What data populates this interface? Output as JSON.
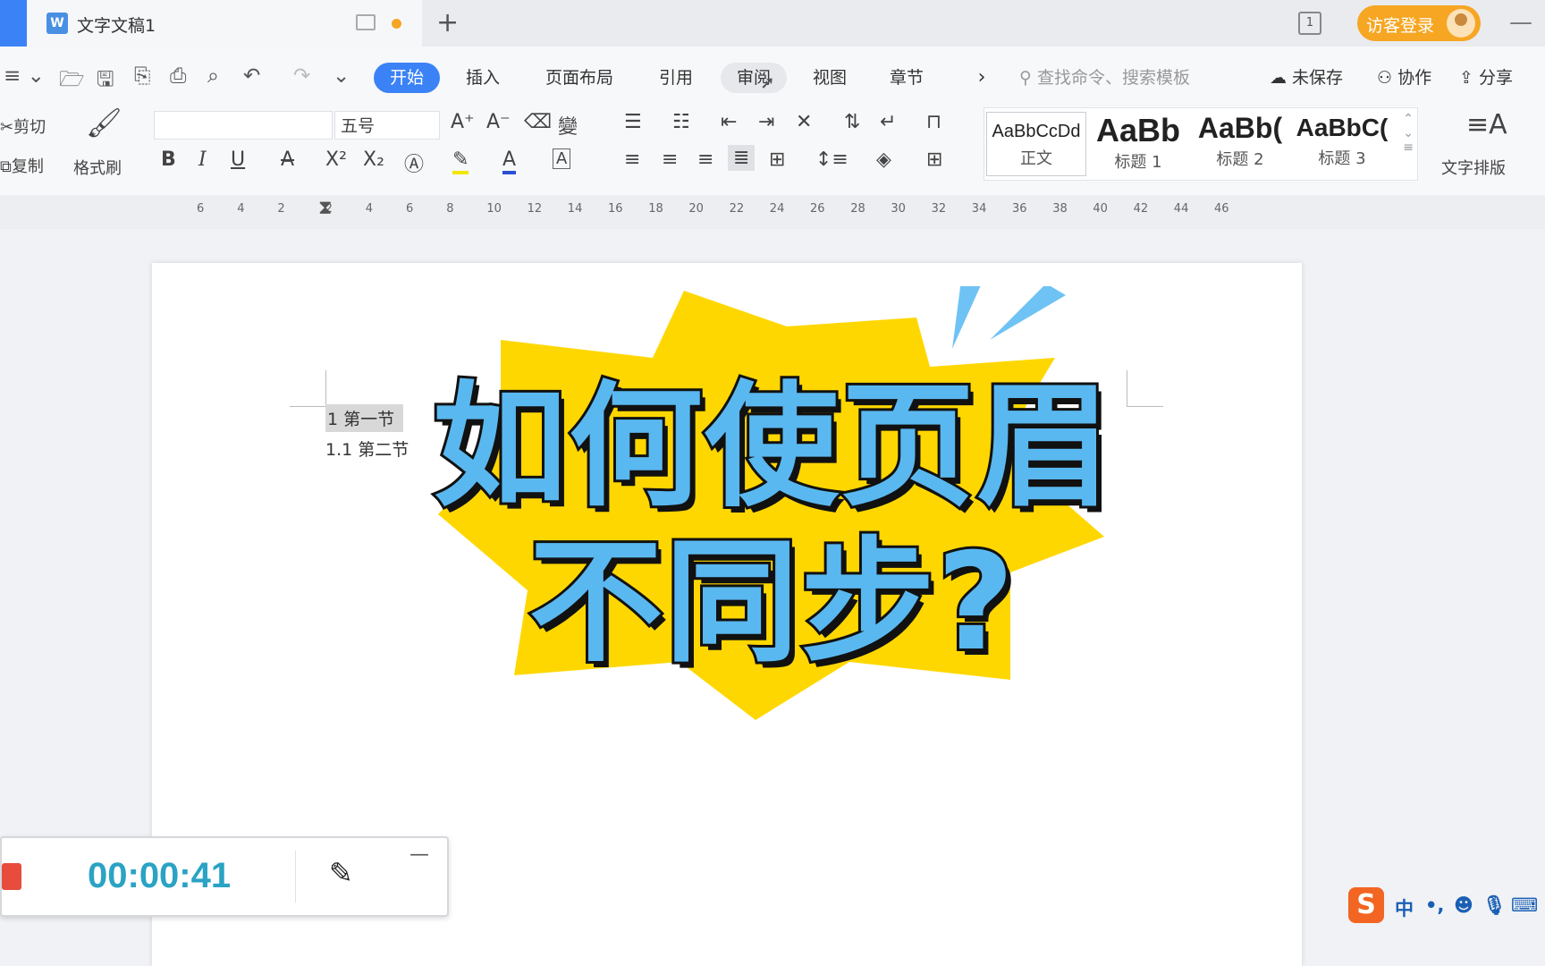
{
  "titlebar": {
    "doc_icon": "W",
    "doc_title": "文字文稿1",
    "new_tab": "+",
    "page_count": "1",
    "login_label": "访客登录",
    "minimize": "—"
  },
  "tabs": {
    "start": "开始",
    "insert": "插入",
    "layout": "页面布局",
    "references": "引用",
    "review": "审阅",
    "view": "视图",
    "chapter": "章节",
    "more": "›"
  },
  "search": {
    "placeholder": "查找命令、搜索模板"
  },
  "right_actions": {
    "unsaved": "未保存",
    "collab": "协作",
    "share": "分享"
  },
  "clipboard": {
    "cut": "剪切",
    "copy": "复制",
    "format_painter": "格式刷"
  },
  "font": {
    "name_value": "",
    "size_value": "五号"
  },
  "format_buttons": {
    "bold": "B",
    "italic": "I",
    "underline": "U",
    "strike": "A",
    "superscript": "X²",
    "subscript": "X₂",
    "font_color": "A",
    "char_border": "A"
  },
  "styles": {
    "items": [
      {
        "preview": "AaBbCcDd",
        "name": "正文"
      },
      {
        "preview": "AaBb",
        "name": "标题 1"
      },
      {
        "preview": "AaBb(",
        "name": "标题 2"
      },
      {
        "preview": "AaBbC(",
        "name": "标题 3"
      }
    ],
    "text_layout": "文字排版"
  },
  "ruler": {
    "ticks": [
      "6",
      "4",
      "2",
      "2",
      "4",
      "6",
      "8",
      "10",
      "12",
      "14",
      "16",
      "18",
      "20",
      "22",
      "24",
      "26",
      "28",
      "30",
      "32",
      "34",
      "36",
      "38",
      "40",
      "42",
      "44",
      "46"
    ]
  },
  "document": {
    "line1": "1 第一节",
    "line2": "1.1  第二节"
  },
  "overlay": {
    "headline_line1": "如何使页眉",
    "headline_line2": "不同步?",
    "burst_color": "#FFD700",
    "text_color": "#5AB8F0"
  },
  "recorder": {
    "time": "00:00:41",
    "minimize": "—"
  },
  "ime": {
    "logo": "S",
    "mode": "中",
    "punct": "•,",
    "emoji": "☻",
    "mic": "🎙",
    "keyboard": "⌨"
  }
}
